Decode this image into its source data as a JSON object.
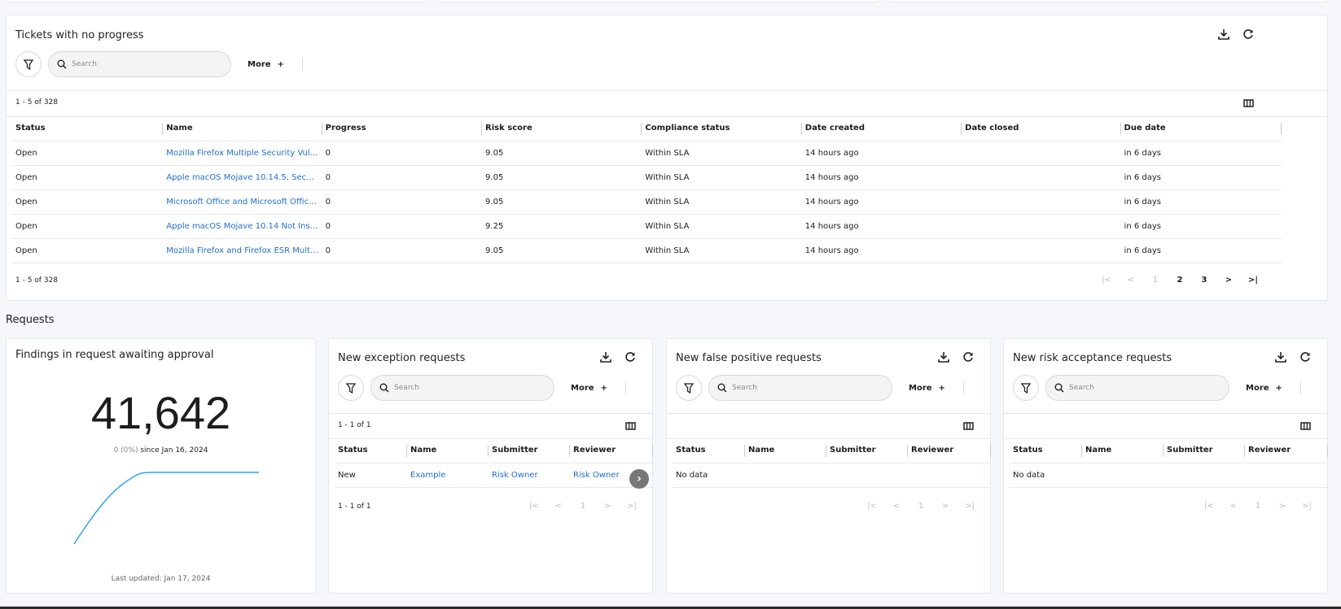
{
  "tickets": {
    "title": "Tickets with no progress",
    "search_placeholder": "Search",
    "more_label": "More",
    "more_icon": "+",
    "count_top": "1 - 5 of 328",
    "count_bottom": "1 - 5 of 328",
    "columns": [
      "Status",
      "Name",
      "Progress",
      "Risk score",
      "Compliance status",
      "Date created",
      "Date closed",
      "Due date"
    ],
    "rows": [
      [
        "Open",
        "Mozilla Firefox Multiple Security Vuln…",
        "0",
        "9.05",
        "Within SLA",
        "14 hours ago",
        "",
        "in 6 days"
      ],
      [
        "Open",
        "Apple macOS Mojave 10.14.5, Securit…",
        "0",
        "9.05",
        "Within SLA",
        "14 hours ago",
        "",
        "in 6 days"
      ],
      [
        "Open",
        "Microsoft Office and Microsoft Office …",
        "0",
        "9.05",
        "Within SLA",
        "14 hours ago",
        "",
        "in 6 days"
      ],
      [
        "Open",
        "Apple macOS Mojave 10.14 Not Instal…",
        "0",
        "9.25",
        "Within SLA",
        "14 hours ago",
        "",
        "in 6 days"
      ],
      [
        "Open",
        "Mozilla Firefox and Firefox ESR Multi…",
        "0",
        "9.05",
        "Within SLA",
        "14 hours ago",
        "",
        "in 6 days"
      ]
    ],
    "pages": [
      "1",
      "2",
      "3"
    ],
    "current_page": "1"
  },
  "requests_section": "Requests",
  "findings": {
    "title": "Findings in request awaiting approval",
    "value": "41,642",
    "delta": "0 (0%)",
    "since": "since Jan 16, 2024",
    "last_updated": "Last updated: Jan 17, 2024",
    "line_color": "#2aa3f5"
  },
  "request_cards": [
    {
      "title": "New exception requests",
      "search_placeholder": "Search",
      "more_label": "More",
      "more_icon": "+",
      "count_top": "1 - 1 of 1",
      "count_bottom": "1 - 1 of 1",
      "columns": [
        "Status",
        "Name",
        "Submitter",
        "Reviewer"
      ],
      "rows": [
        [
          "New",
          "Example",
          "Risk Owner",
          "Risk Owner"
        ]
      ],
      "pages": [
        "1"
      ]
    },
    {
      "title": "New false positive requests",
      "search_placeholder": "Search",
      "more_label": "More",
      "more_icon": "+",
      "count_top": "",
      "count_bottom": "",
      "columns": [
        "Status",
        "Name",
        "Submitter",
        "Reviewer"
      ],
      "rows": [],
      "empty": "No data",
      "pages": [
        "1"
      ]
    },
    {
      "title": "New risk acceptance requests",
      "search_placeholder": "Search",
      "more_label": "More",
      "more_icon": "+",
      "count_top": "",
      "count_bottom": "",
      "columns": [
        "Status",
        "Name",
        "Submitter",
        "Reviewer"
      ],
      "rows": [],
      "empty": "No data",
      "pages": [
        "1"
      ]
    }
  ],
  "colors": {
    "link": "#1f6fd1",
    "background": "#f6f7fb",
    "card": "#ffffff"
  }
}
